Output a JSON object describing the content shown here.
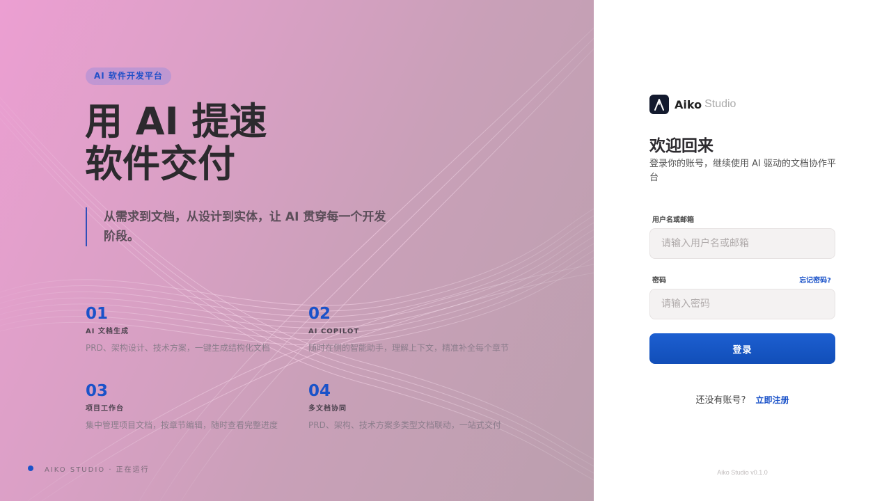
{
  "hero": {
    "badge": "AI 软件开发平台",
    "headline": "用 AI 提速\n软件交付",
    "subhead": "从需求到文档，从设计到实体，让 AI 贯穿每一个开发阶段。",
    "features": [
      {
        "num": "01",
        "title": "AI 文档生成",
        "desc": "PRD、架构设计、技术方案，一键生成结构化文档"
      },
      {
        "num": "02",
        "title": "AI COPILOT",
        "desc": "随时在侧的智能助手，理解上下文，精准补全每个章节"
      },
      {
        "num": "03",
        "title": "项目工作台",
        "desc": "集中管理项目文档，按章节编辑，随时查看完整进度"
      },
      {
        "num": "04",
        "title": "多文档协同",
        "desc": "PRD、架构、技术方案多类型文档联动，一站式交付"
      }
    ],
    "status_text": "AIKO STUDIO · 正在运行"
  },
  "login": {
    "brand_name": "Aiko",
    "brand_suffix": "Studio",
    "title": "欢迎回来",
    "subtitle": "登录你的账号，继续使用 AI 驱动的文档协作平台",
    "username_label": "用户名或邮箱",
    "username_placeholder": "请输入用户名或邮箱",
    "password_label": "密码",
    "forgot_label": "忘记密码?",
    "password_placeholder": "请输入密码",
    "submit_label": "登录",
    "signup_prompt": "还没有账号?",
    "signup_link": "立即注册",
    "version": "Aiko Studio v0.1.0"
  },
  "colors": {
    "accent": "#1a52c9",
    "hero_gradient_start": "#ec9fd2",
    "hero_gradient_end": "#bb9fae",
    "logo_bg": "#131a2e"
  },
  "icons": {
    "logo": "aiko-a-logo-icon",
    "status": "status-dot-icon"
  }
}
